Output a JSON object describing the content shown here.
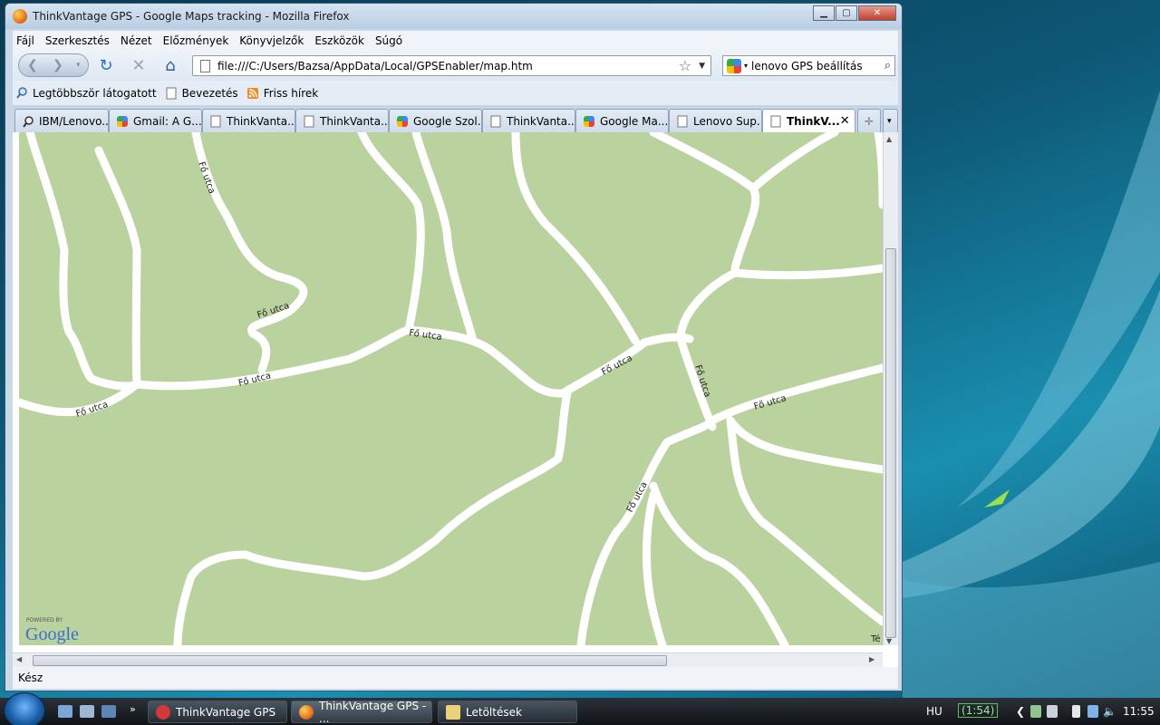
{
  "window": {
    "title": "ThinkVantage GPS - Google Maps tracking - Mozilla Firefox"
  },
  "menu": [
    "Fájl",
    "Szerkesztés",
    "Nézet",
    "Előzmények",
    "Könyvjelzők",
    "Eszközök",
    "Súgó"
  ],
  "nav": {
    "url": "file:///C:/Users/Bazsa/AppData/Local/GPSEnabler/map.htm",
    "search_value": "lenovo GPS beállítás"
  },
  "bookmarks": [
    "Legtöbbször látogatott",
    "Bevezetés",
    "Friss hírek"
  ],
  "tabs": [
    "IBM/Lenovo...",
    "Gmail: A G...",
    "ThinkVanta...",
    "ThinkVanta...",
    "Google Szol...",
    "ThinkVanta...",
    "Google Ma...",
    "Lenovo Sup...",
    "ThinkV..."
  ],
  "map": {
    "street_label": "Fő utca",
    "powered_by": "POWERED BY",
    "google": "Google",
    "terms_clip": "Té"
  },
  "status": "Kész",
  "taskbar": {
    "items": [
      "ThinkVantage GPS",
      "ThinkVantage GPS - ...",
      "Letöltések"
    ],
    "lang": "HU",
    "battery": "(1:54)",
    "clock": "11:55"
  }
}
